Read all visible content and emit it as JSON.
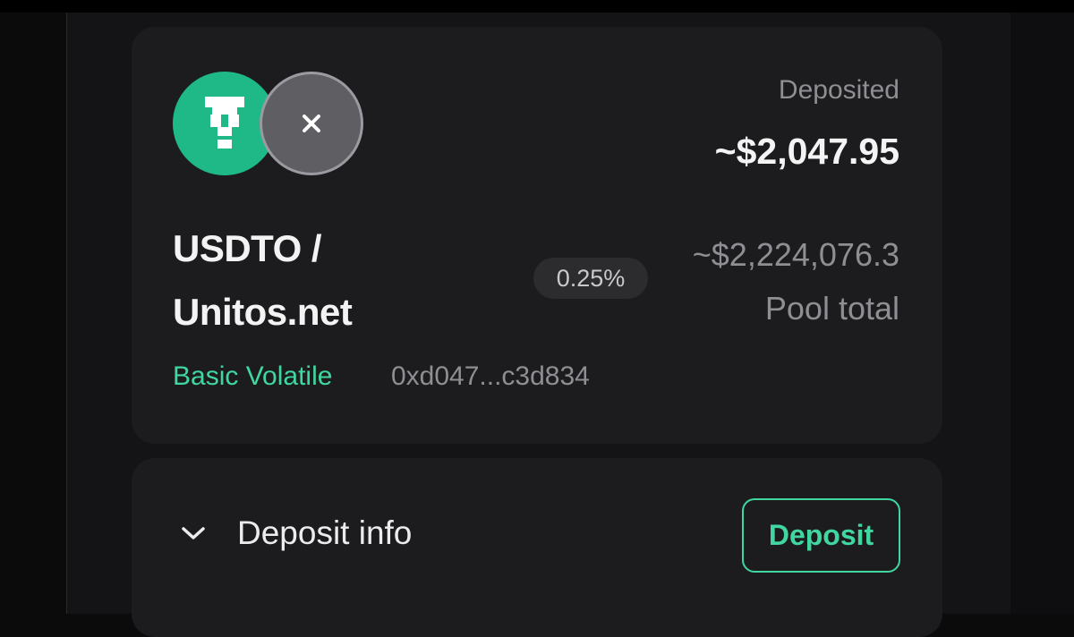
{
  "pool": {
    "token_a_icon": "tether-icon",
    "token_b_icon": "close-icon",
    "pair_line1": "USDTO /",
    "pair_line2": "Unitos.net",
    "pool_type": "Basic Volatile",
    "address": "0xd047...c3d834",
    "fee": "0.25%",
    "deposited_label": "Deposited",
    "deposited_value": "~$2,047.95",
    "pool_total_value": "~$2,224,076.3",
    "pool_total_label": "Pool total"
  },
  "deposit_section": {
    "toggle_icon": "chevron-down-icon",
    "label": "Deposit info",
    "button_label": "Deposit"
  },
  "colors": {
    "accent": "#3fd79f",
    "token_a_bg": "#1fb988",
    "token_b_bg": "#5e5e63",
    "card_bg": "#1c1c1f",
    "page_bg": "#141416"
  }
}
